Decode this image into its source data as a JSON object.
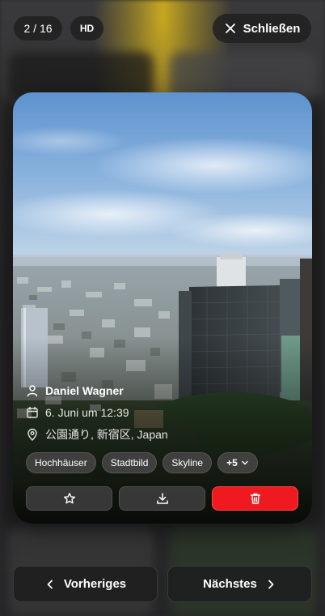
{
  "viewer": {
    "counter": "2 / 16",
    "quality_badge": "HD",
    "close_label": "Schließen"
  },
  "photo": {
    "author": "Daniel Wagner",
    "date": "6. Juni um 12:39",
    "location": "公園通り, 新宿区, Japan",
    "tags": [
      "Hochhäuser",
      "Stadtbild",
      "Skyline"
    ],
    "more_tags": "+5"
  },
  "navigation": {
    "previous_label": "Vorheriges",
    "next_label": "Nächstes"
  },
  "colors": {
    "delete_accent": "#ee1a1f",
    "overlay": "#1e1e1e"
  },
  "icons": {
    "close": "close-icon",
    "author": "user-icon",
    "date": "calendar-icon",
    "location": "map-pin-icon",
    "favorite": "star-icon",
    "download": "download-icon",
    "delete": "trash-icon",
    "previous": "chevron-left-icon",
    "next": "chevron-right-icon"
  }
}
